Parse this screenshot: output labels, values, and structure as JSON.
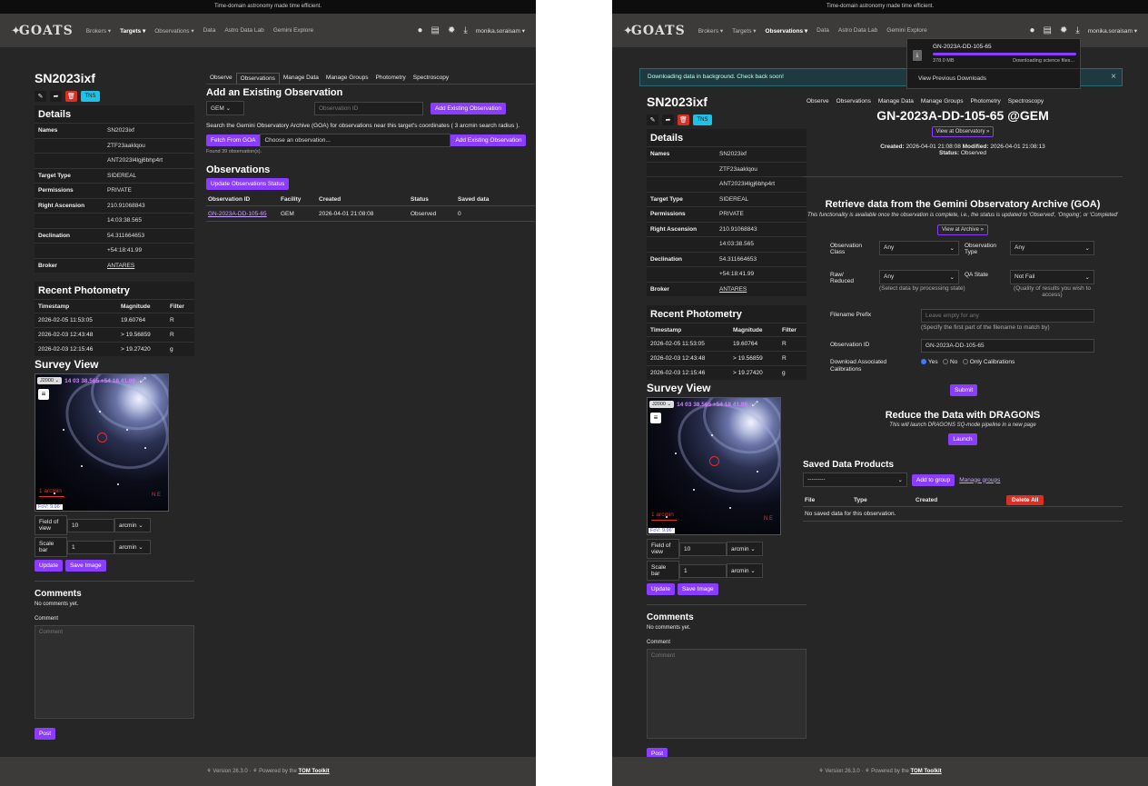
{
  "banner": "Time-domain astronomy made time efficient.",
  "logo_text": "GOATS",
  "nav": {
    "brokers": "Brokers ▾",
    "targets": "Targets ▾",
    "observations": "Observations ▾",
    "data": "Data",
    "astro_data_lab": "Astro Data Lab",
    "gemini_explore": "Gemini Explore",
    "user": "monika.soraisam ▾"
  },
  "target": {
    "name": "SN2023ixf",
    "tns": "TNS",
    "details_title": "Details",
    "names_label": "Names",
    "names": [
      "SN2023ixf",
      "ZTF23aaklqou",
      "ANT2023l4lgj6bhp4rt"
    ],
    "type_label": "Target Type",
    "type": "SIDEREAL",
    "perm_label": "Permissions",
    "perm": "PRIVATE",
    "ra_label": "Right Ascension",
    "ra_deg": "210.91068843",
    "ra_hms": "14:03:38.565",
    "dec_label": "Declination",
    "dec_deg": "54.311664653",
    "dec_dms": "+54:18:41.99",
    "broker_label": "Broker",
    "broker": "ANTARES"
  },
  "photometry": {
    "title": "Recent Photometry",
    "headers": [
      "Timestamp",
      "Magnitude",
      "Filter"
    ],
    "rows": [
      [
        "2026-02-05 11:53:05",
        "19.60764",
        "R"
      ],
      [
        "2026-02-03 12:43:48",
        "> 19.56859",
        "R"
      ],
      [
        "2026-02-03 12:15:46",
        "> 19.27420",
        "g"
      ]
    ]
  },
  "survey": {
    "title": "Survey View",
    "frame": "J2000 ⌄",
    "coords": "14 03 38.565 +54 18 41.99",
    "scale_text": "1 arcmin",
    "fov_text": "FoV: 9.96'",
    "fov_label": "Field of view",
    "fov_value": "10",
    "fov_unit": "arcmin ⌄",
    "sb_label": "Scale bar",
    "sb_value": "1",
    "sb_unit": "arcmin ⌄",
    "update": "Update",
    "save": "Save Image",
    "ne": "N E"
  },
  "comments": {
    "title": "Comments",
    "none": "No comments yet.",
    "label": "Comment",
    "placeholder": "Comment",
    "post": "Post"
  },
  "tabs": [
    "Observe",
    "Observations",
    "Manage Data",
    "Manage Groups",
    "Photometry",
    "Spectroscopy"
  ],
  "left_main": {
    "add_title": "Add an Existing Observation",
    "facility": "GEM ⌄",
    "obs_id_ph": "Observation ID",
    "add_btn": "Add Existing Observation",
    "search_text": "Search the Gemini Observatory Archive (GOA) for observations near this target's coordinates ( 3 arcmin search radius ).",
    "fetch_btn": "Fetch From GOA",
    "choose": "Choose an observation...",
    "found": "Found 39 observation(s).",
    "obs_title": "Observations",
    "update_status": "Update Observations Status",
    "obs_headers": [
      "Observation ID",
      "Facility",
      "Created",
      "Status",
      "Saved data"
    ],
    "obs_row": [
      "GN-2023A-DD-105-65",
      "GEM",
      "2026-04-01 21:08:08",
      "Observed",
      "0"
    ]
  },
  "right_main": {
    "alert": "Downloading data in background. Check back soon!",
    "dl_name": "GN-2023A-DD-105-65",
    "dl_size": "378.0 MB",
    "dl_status": "Downloading science files...",
    "dl_progress": 1.0,
    "dl_prev": "View Previous Downloads",
    "obs_head": "GN-2023A-DD-105-65 @GEM",
    "view_obs": "View at Observatory »",
    "created_l": "Created:",
    "created": "2026-04-01 21:08:08",
    "modified_l": "Modified:",
    "modified": "2026-04-01 21:08:13",
    "status_l": "Status:",
    "status": "Observed",
    "goa_title": "Retrieve data from the Gemini Observatory Archive (GOA)",
    "goa_note": "This functionality is available once the observation is complete, i.e., the status is updated to 'Observed', 'Ongoing', or 'Completed'",
    "view_archive": "View at Archive »",
    "obs_class_l": "Observation Class",
    "obs_class": "Any",
    "obs_type_l": "Observation Type",
    "obs_type": "Any",
    "raw_l": "Raw/ Reduced",
    "raw": "Any",
    "raw_help": "(Select data by processing state)",
    "qa_l": "QA State",
    "qa": "Not Fail",
    "qa_help": "(Quality of results you wish to access)",
    "prefix_l": "Filename Prefix",
    "prefix_ph": "Leave empty for any",
    "prefix_help": "(Specify the first part of the filename to match by)",
    "obsid_l": "Observation ID",
    "obsid": "GN-2023A-DD-105-65",
    "calib_l": "Download Associated Calibrations",
    "calib_yes": "Yes",
    "calib_no": "No",
    "calib_only": "Only Calibrations",
    "submit": "Submit",
    "dragons_title": "Reduce the Data with DRAGONS",
    "dragons_note": "This will launch DRAGONS SQ-mode pipeline in a new page",
    "launch": "Launch",
    "saved_title": "Saved Data Products",
    "group_sel": "---------",
    "add_group": "Add to group",
    "manage_groups": "Manage groups",
    "file_h": "File",
    "type_h": "Type",
    "created_h": "Created",
    "delete_all": "Delete All",
    "no_saved": "No saved data for this observation."
  },
  "footer": {
    "version": "⚘ Version 26.3.0 · ⚘ Powered by the",
    "tom": "TOM Toolkit"
  },
  "colors": {
    "accent": "#8b3dff",
    "danger": "#d93025",
    "tns": "#1cc2e8",
    "bg": "#262626"
  }
}
